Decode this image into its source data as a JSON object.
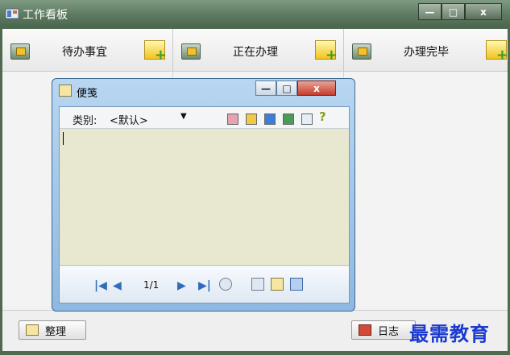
{
  "main_window": {
    "title": "工作看板",
    "controls": {
      "minimize": "—",
      "maximize": "□",
      "close": "x"
    }
  },
  "columns": [
    {
      "label": "待办事宜"
    },
    {
      "label": "正在办理"
    },
    {
      "label": "办理完毕"
    }
  ],
  "footer": {
    "organize_label": "整理",
    "log_label": "日志"
  },
  "watermark": "最需教育",
  "note_window": {
    "title": "便笺",
    "controls": {
      "minimize": "—",
      "maximize": "□",
      "close": "x"
    },
    "category_label": "类别:",
    "category_value": "<默认>",
    "color_swatches": [
      "#e7a3b4",
      "#f1c94a",
      "#3f7cd6",
      "#4b9a57",
      "#e8eef5"
    ],
    "help_glyph": "?",
    "content": "",
    "pager": {
      "current": "1/1"
    }
  }
}
